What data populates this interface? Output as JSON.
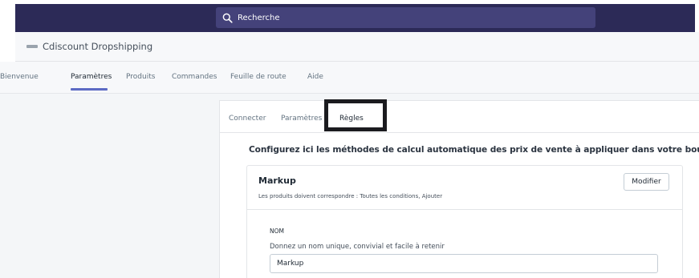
{
  "topbar": {
    "search_placeholder": "Recherche",
    "bg_color": "#2c2a57"
  },
  "app": {
    "title": "Cdiscount Dropshipping"
  },
  "nav": {
    "items": [
      {
        "label": "Bienvenue"
      },
      {
        "label": "Paramètres",
        "active": true
      },
      {
        "label": "Produits"
      },
      {
        "label": "Commandes"
      },
      {
        "label": "Feuille de route"
      },
      {
        "label": "Aide"
      }
    ]
  },
  "settings": {
    "tabs": [
      {
        "label": "Connecter"
      },
      {
        "label": "Paramètres"
      },
      {
        "label": "Règles",
        "active": true
      }
    ],
    "description": "Configurez ici les méthodes de calcul automatique des prix de vente à appliquer dans votre boutique",
    "rule": {
      "title": "Markup",
      "subtitle": "Les produits doivent correspondre : Toutes les conditions, Ajouter",
      "edit_label": "Modifier",
      "field_label": "NOM",
      "field_help": "Donnez un nom unique, convivial et facile à retenir",
      "field_value": "Markup"
    }
  }
}
